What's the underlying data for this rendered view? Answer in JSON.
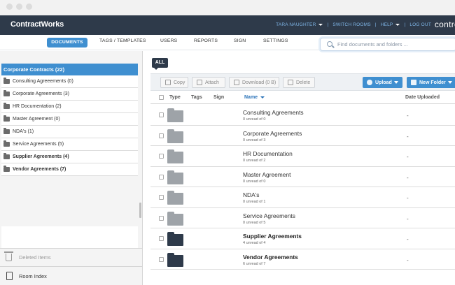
{
  "app": {
    "logo": "ContractWorks",
    "brand_right": "contro"
  },
  "top_links": {
    "user": "TARA NAUGHTER",
    "switch": "SWITCH ROOMS",
    "help": "HELP",
    "logout": "LOG OUT",
    "separator": "|"
  },
  "tabs": [
    {
      "label": "DOCUMENTS",
      "active": true
    },
    {
      "label": "TAGS / TEMPLATES"
    },
    {
      "label": "USERS"
    },
    {
      "label": "REPORTS"
    },
    {
      "label": "SIGN"
    },
    {
      "label": "SETTINGS"
    }
  ],
  "search": {
    "placeholder": "Find documents and folders ..."
  },
  "sidebar": {
    "root": "Corporate Contracts (22)",
    "items": [
      {
        "label": "Consulting Agreeements (0)",
        "bold": false
      },
      {
        "label": "Corporate Agreements (3)",
        "bold": false
      },
      {
        "label": "HR Documentation (2)",
        "bold": false
      },
      {
        "label": "Master Agreement (0)",
        "bold": false
      },
      {
        "label": "NDA's (1)",
        "bold": false
      },
      {
        "label": "Service Agreements (5)",
        "bold": false
      },
      {
        "label": "Supplier Agreements (4)",
        "bold": true
      },
      {
        "label": "Vendor Agreements (7)",
        "bold": true
      }
    ],
    "deleted": "Deleted Items",
    "room_index": "Room Index"
  },
  "main": {
    "filter_badge": "ALL",
    "toolbar": {
      "copy": "Copy",
      "attach": "Attach",
      "download": "Download (0 B)",
      "delete": "Delete",
      "upload": "Upload",
      "new_folder": "New Folder"
    },
    "columns": {
      "type": "Type",
      "tags": "Tags",
      "sign": "Sign",
      "name": "Name",
      "date": "Date Uploaded"
    },
    "rows": [
      {
        "name": "Consulting Agreements",
        "sub": "0 unread of 0",
        "date": "-",
        "bold": false,
        "dark": false
      },
      {
        "name": "Corporate Agreements",
        "sub": "0 unread of 3",
        "date": "-",
        "bold": false,
        "dark": false
      },
      {
        "name": "HR Documentation",
        "sub": "0 unread of 2",
        "date": "-",
        "bold": false,
        "dark": false
      },
      {
        "name": "Master Agreement",
        "sub": "0 unread of 0",
        "date": "-",
        "bold": false,
        "dark": false
      },
      {
        "name": "NDA's",
        "sub": "0 unread of 1",
        "date": "-",
        "bold": false,
        "dark": false
      },
      {
        "name": "Service Agreements",
        "sub": "0 unread of 5",
        "date": "-",
        "bold": false,
        "dark": false
      },
      {
        "name": "Supplier Agreements",
        "sub": "4 unread of 4",
        "date": "-",
        "bold": true,
        "dark": true
      },
      {
        "name": "Vendor Agreements",
        "sub": "6 unread of 7",
        "date": "-",
        "bold": true,
        "dark": true
      }
    ]
  },
  "colors": {
    "nav_bg": "#2e3a4a",
    "accent_blue": "#3f8fd0",
    "link_blue": "#7fb6e8",
    "folder_grey": "#9ea3a8",
    "folder_dark": "#2e3a4a"
  }
}
